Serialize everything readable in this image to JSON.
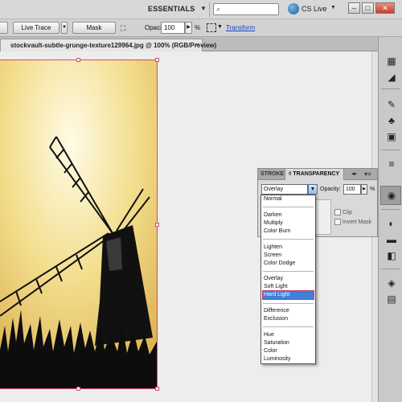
{
  "app_bar": {
    "workspace": "ESSENTIALS",
    "search_placeholder": "",
    "cs_live": "CS Live",
    "window_buttons": [
      "–",
      "□",
      "✕"
    ]
  },
  "control_bar": {
    "live_trace": "Live Trace",
    "mask": "Mask",
    "opacity_label": "Opacity:",
    "opacity_value": "100",
    "opacity_unit": "%",
    "transform": "Transform"
  },
  "document_tab": {
    "title": "stockvault-subtle-grunge-texture129964.jpg @ 100% (RGB/Preview)",
    "close": "×"
  },
  "panel": {
    "tab_stroke": "STROKE",
    "tab_transparency": "◊ TRANSPARENCY",
    "blend_mode": "Overlay",
    "opacity_label": "Opacity:",
    "opacity_value": "100",
    "opacity_unit": "%",
    "clip": "Clip",
    "invert_mask": "Invert Mask"
  },
  "blend_menu": {
    "items": [
      "Normal",
      "Darken",
      "Multiply",
      "Color Burn",
      "Lighten",
      "Screen",
      "Color Dodge",
      "Overlay",
      "Soft Light",
      "Hard Light",
      "Difference",
      "Exclusion",
      "Hue",
      "Saturation",
      "Color",
      "Luminosity"
    ],
    "selected": "Hard Light"
  },
  "colors": {
    "selection_highlight": "#3d7fd9",
    "artboard_border": "#d8467a",
    "link": "#1642c8"
  },
  "dock_icons": [
    "color-guide-icon",
    "gradient-icon",
    "brushes-icon",
    "symbols-icon",
    "graphic-styles-icon",
    "stroke-icon",
    "transparency-icon",
    "appearance-icon",
    "align-icon",
    "layers-icon"
  ]
}
